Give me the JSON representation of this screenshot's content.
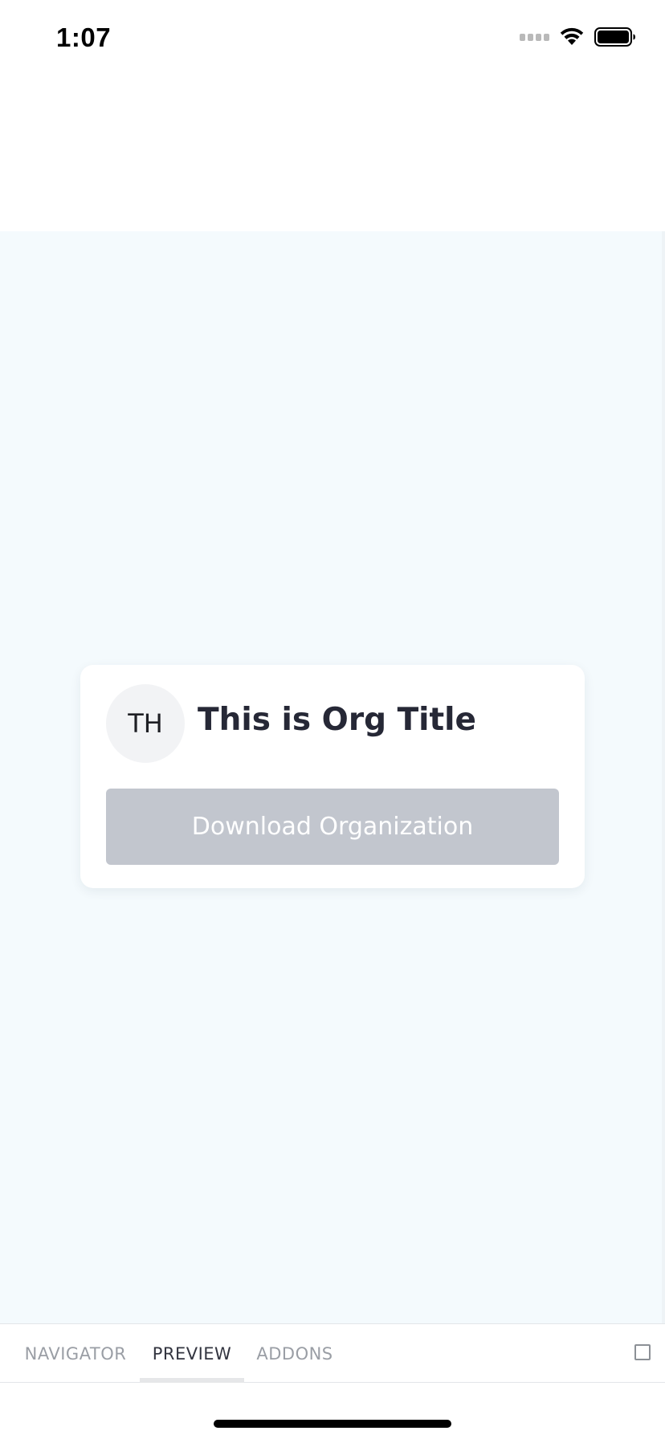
{
  "status_bar": {
    "time": "1:07"
  },
  "card": {
    "avatar_initials": "TH",
    "title": "This is Org Title",
    "download_button_label": "Download Organization"
  },
  "tabs": [
    {
      "label": "NAVIGATOR",
      "active": false
    },
    {
      "label": "PREVIEW",
      "active": true
    },
    {
      "label": "ADDONS",
      "active": false
    }
  ],
  "colors": {
    "canvas_background": "#f4fafd",
    "button_disabled": "#c2c6ce",
    "title_text": "#262836",
    "tab_inactive": "#9a9ea5",
    "tab_active": "#333540"
  },
  "icons": {
    "signal": "cellular-signal-icon",
    "wifi": "wifi-icon",
    "battery": "battery-icon",
    "fullscreen": "fullscreen-icon"
  }
}
